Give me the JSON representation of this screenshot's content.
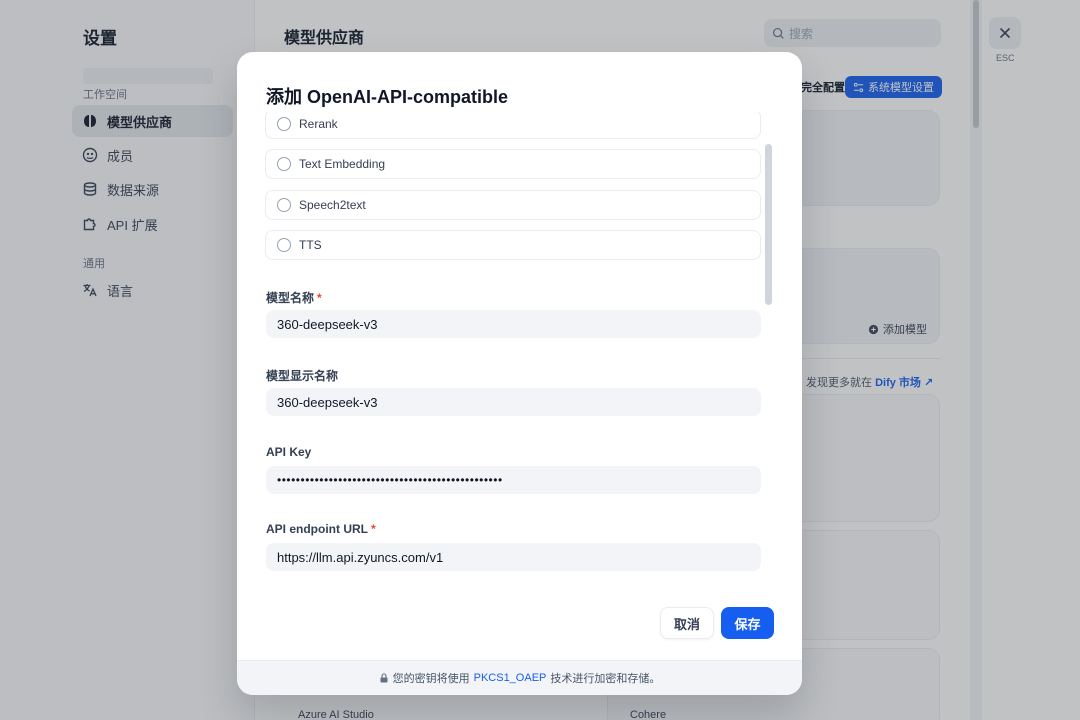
{
  "sidebar": {
    "title": "设置",
    "group_workspace": "工作空间",
    "group_general": "通用",
    "items": [
      {
        "label": "模型供应商",
        "icon": "brain-icon",
        "active": true
      },
      {
        "label": "成员",
        "icon": "users-icon",
        "active": false
      },
      {
        "label": "数据来源",
        "icon": "database-icon",
        "active": false
      },
      {
        "label": "API 扩展",
        "icon": "puzzle-icon",
        "active": false
      },
      {
        "label": "语言",
        "icon": "translate-icon",
        "active": false
      }
    ]
  },
  "main": {
    "title": "模型供应商",
    "search_placeholder": "搜索",
    "partial_config_label": "完全配置",
    "system_model_button": "系统模型设置",
    "add_model_label": "添加模型",
    "discover_prefix": "发现更多就在",
    "discover_link": "Dify 市场",
    "provider_left": "Azure AI Studio",
    "provider_right": "Cohere"
  },
  "close": {
    "label": "ESC"
  },
  "modal": {
    "title": "添加 OpenAI-API-compatible",
    "model_types": [
      "Rerank",
      "Text Embedding",
      "Speech2text",
      "TTS"
    ],
    "fields": {
      "model_name": {
        "label": "模型名称",
        "required": true,
        "value": "360-deepseek-v3"
      },
      "display_name": {
        "label": "模型显示名称",
        "required": false,
        "value": "360-deepseek-v3"
      },
      "api_key": {
        "label": "API Key",
        "required": false,
        "value": "••••••••••••••••••••••••••••••••••••••••••••••••"
      },
      "endpoint": {
        "label": "API endpoint URL",
        "required": true,
        "value": "https://llm.api.zyuncs.com/v1"
      }
    },
    "cancel_label": "取消",
    "save_label": "保存",
    "footer": {
      "prefix": "您的密钥将使用",
      "link": "PKCS1_OAEP",
      "suffix": "技术进行加密和存储。"
    }
  },
  "colors": {
    "accent": "#155eef",
    "required": "#f04438",
    "overlay": "#3c4048"
  }
}
